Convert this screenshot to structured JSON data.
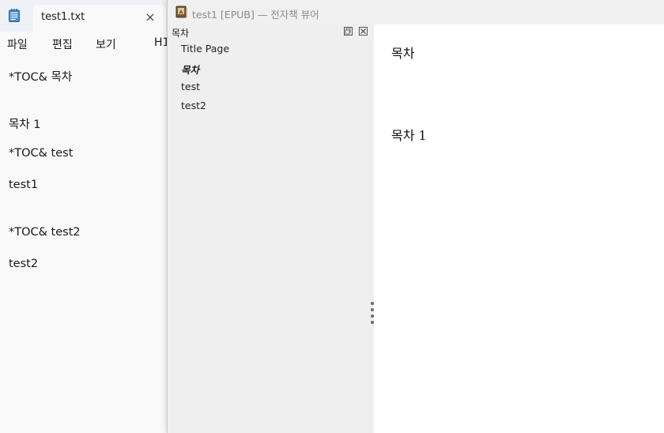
{
  "notepad": {
    "tab_title": "test1.txt",
    "menu": [
      "파일",
      "편집",
      "보기",
      "H1"
    ],
    "lines": [
      "*TOC& 목차",
      "목차 1",
      "*TOC& test",
      "test1",
      "*TOC& test2",
      "test2"
    ]
  },
  "viewer": {
    "title": "test1 [EPUB] — 전자책 뷰어",
    "toc": {
      "header": "목차",
      "items": [
        "Title Page",
        "목차",
        "test",
        "test2"
      ],
      "active_index": 1
    },
    "content": {
      "heading": "목차",
      "body": "목차 1"
    }
  },
  "colors": {
    "notepad_bg": "#f9f9f9",
    "tabbar_bg": "#eef1f5",
    "toc_bg": "#efefef",
    "accent_icon": "#3a6fb0"
  },
  "icons": {
    "notepad_app": "notepad-icon",
    "tab_close": "close-icon",
    "viewer_app": "book-icon",
    "toc_float": "float-icon",
    "toc_close": "close-icon"
  }
}
